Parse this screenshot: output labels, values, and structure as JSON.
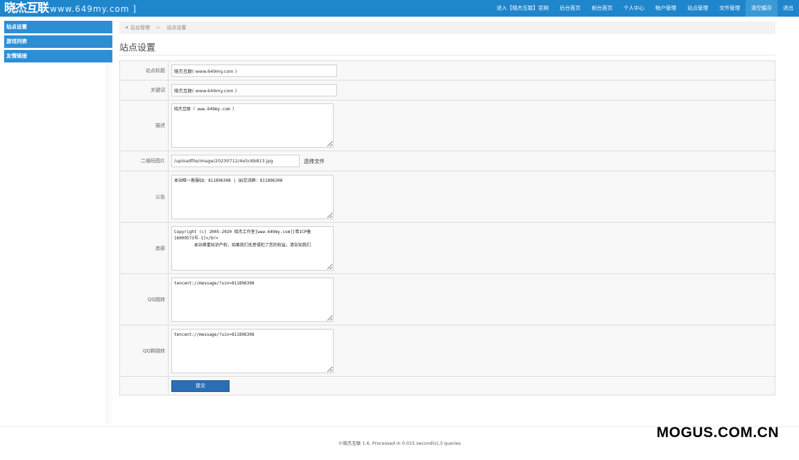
{
  "brand": {
    "logo": "晓杰互联",
    "url": "www.649my.com ]"
  },
  "topnav": [
    {
      "label": "进入【晓杰互联】官网",
      "active": false
    },
    {
      "label": "后台首页",
      "active": false
    },
    {
      "label": "前台首页",
      "active": false
    },
    {
      "label": "个人中心",
      "active": false
    },
    {
      "label": "帐户管理",
      "active": false
    },
    {
      "label": "站点管理",
      "active": false
    },
    {
      "label": "文件管理",
      "active": false
    },
    {
      "label": "清空缓存",
      "active": true
    },
    {
      "label": "退出",
      "active": false
    }
  ],
  "sidebar": {
    "items": [
      {
        "label": "站点设置"
      },
      {
        "label": "游戏列表"
      },
      {
        "label": "友情链接"
      }
    ]
  },
  "breadcrumb": {
    "home": "后台管理",
    "separator": ">",
    "current": "站点设置"
  },
  "page_title": "站点设置",
  "form": {
    "site_title": {
      "label": "站点标题",
      "value": "晓杰互联( www.649my.com )"
    },
    "keywords": {
      "label": "关键词",
      "value": "晓杰互联( www.649my.com )"
    },
    "description": {
      "label": "描述",
      "value": "晓杰互联（ www.649my.com ）"
    },
    "qrcode": {
      "label": "二维码图片",
      "value": "/uploadfile/image/20230712/4e5c6b813.jpg",
      "button": "选择文件"
    },
    "notice": {
      "label": "公告",
      "value": "本站唯一客服QQ：811896308 | QQ交流群：811896308"
    },
    "footer": {
      "label": "底部",
      "value": "Copyright (c) 2005-2020 晓杰工作室[www.649my.com][粤ICP备16009573号-1]</br>\n        本站尊重知识产权，如果我们无意侵犯了您的权益，请告知我们"
    },
    "qq_link": {
      "label": "QQ跳转",
      "value": "tencent://message/?uin=811896308"
    },
    "qq_group_link": {
      "label": "QQ群跳转",
      "value": "tencent://message/?uin=811896308"
    },
    "submit": "提交"
  },
  "footer": {
    "text": "©晓杰互联 1.6. Processed in 0.015 second(s),3 queries"
  },
  "watermark": "MOGUS.COM.CN",
  "colors": {
    "topbar": "#1f86cc",
    "sidebar_item": "#2d8ed4",
    "submit": "#2a6fb4"
  }
}
